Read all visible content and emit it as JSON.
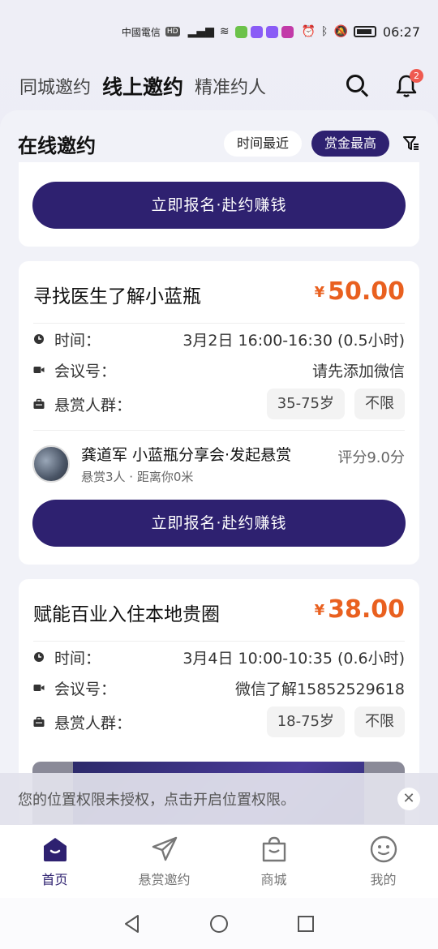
{
  "status_bar": {
    "carrier": "中國電信",
    "hd": "HD",
    "time": "06:27"
  },
  "header": {
    "tabs": [
      "同城邀约",
      "线上邀约",
      "精准约人"
    ],
    "active_tab": 1,
    "notification_count": "2"
  },
  "panel": {
    "title": "在线邀约",
    "sort_options": [
      "时间最近",
      "赏金最高"
    ],
    "active_sort": 1
  },
  "cards": [
    {
      "button_label": "立即报名·赴约赚钱"
    },
    {
      "title": "寻找医生了解小蓝瓶",
      "currency": "¥",
      "price": "50.00",
      "time_label": "时间：",
      "time_value": "3月2日 16:00-16:30 (0.5小时)",
      "meeting_label": "会议号：",
      "meeting_value": "请先添加微信",
      "audience_label": "悬赏人群：",
      "audience_tags": [
        "35-75岁",
        "不限"
      ],
      "host_name": "龚道军 小蓝瓶分享会·发起悬赏",
      "host_sub": "悬赏3人 · 距离你0米",
      "host_score": "评分9.0分",
      "button_label": "立即报名·赴约赚钱"
    },
    {
      "title": "赋能百业入住本地贵圈",
      "currency": "¥",
      "price": "38.00",
      "time_label": "时间：",
      "time_value": "3月4日 10:00-10:35 (0.6小时)",
      "meeting_label": "会议号：",
      "meeting_value": "微信了解15852529618",
      "audience_label": "悬赏人群：",
      "audience_tags": [
        "18-75岁",
        "不限"
      ]
    }
  ],
  "toast": {
    "text": "您的位置权限未授权，点击开启位置权限。",
    "close": "✕"
  },
  "bottom_nav": [
    {
      "label": "首页",
      "icon": "home-icon",
      "active": true
    },
    {
      "label": "悬赏邀约",
      "icon": "send-icon",
      "active": false
    },
    {
      "label": "商城",
      "icon": "shopping-bag-icon",
      "active": false
    },
    {
      "label": "我的",
      "icon": "smile-icon",
      "active": false
    }
  ],
  "colors": {
    "primary": "#2e2170",
    "price": "#e9601f",
    "badge": "#ef5a50"
  }
}
